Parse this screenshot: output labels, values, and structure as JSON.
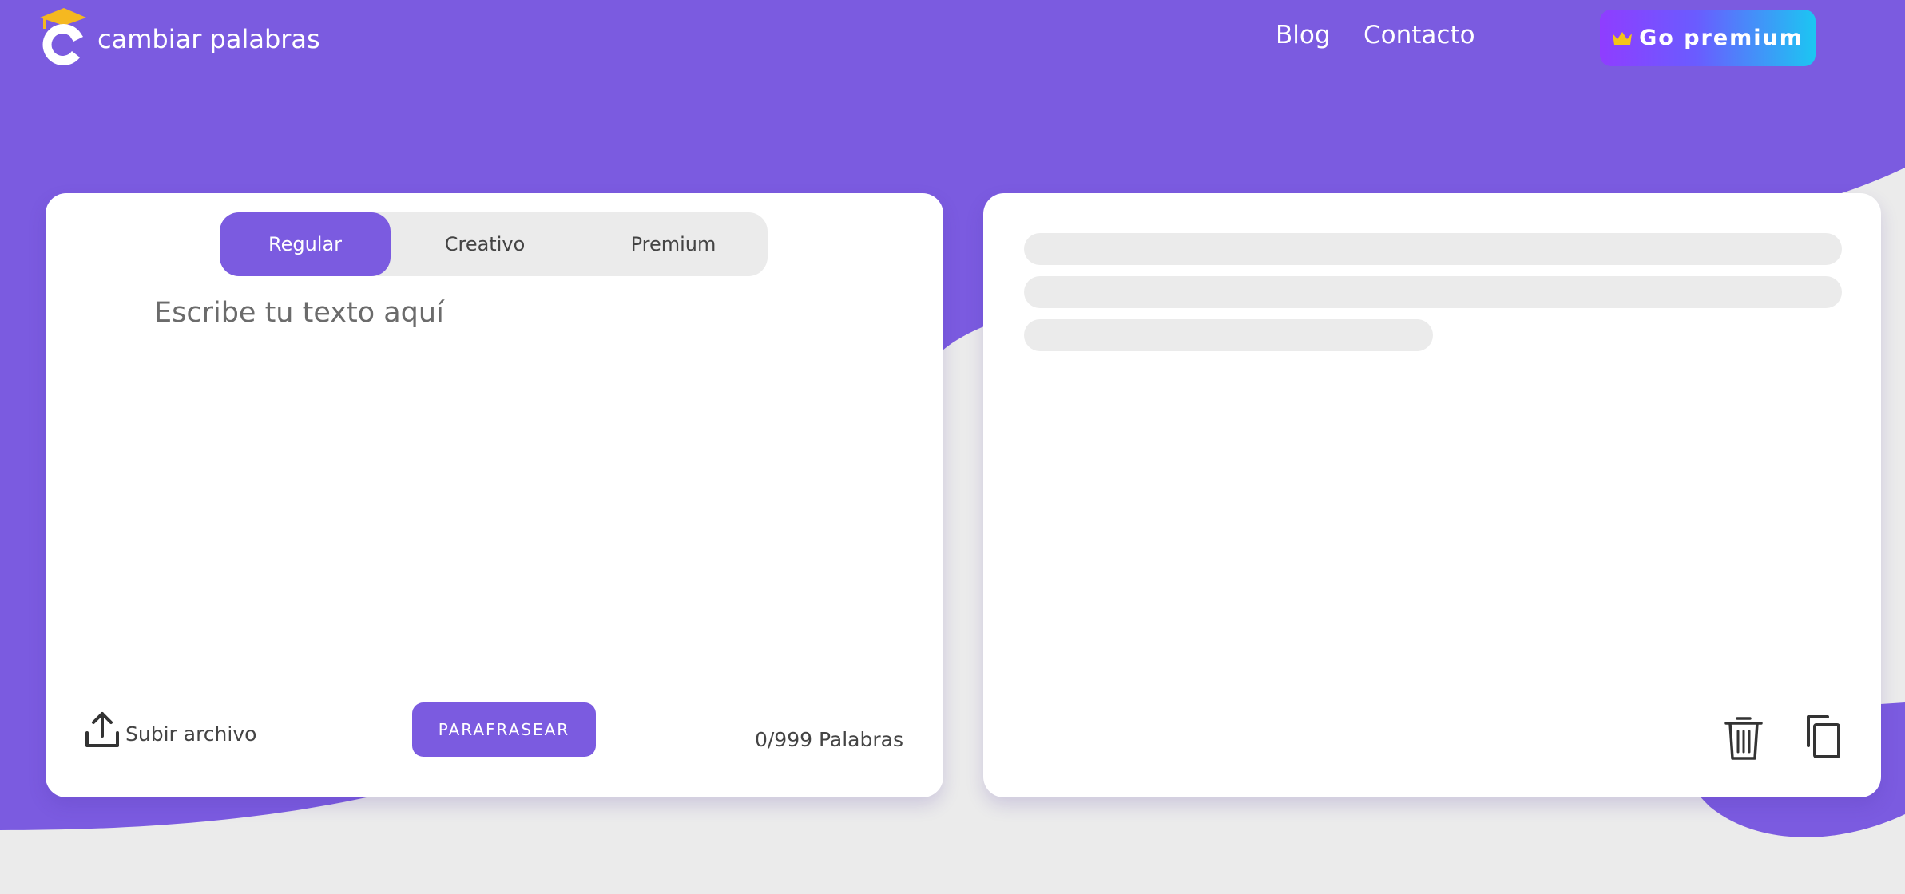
{
  "header": {
    "logo_text": "cambiar palabras",
    "nav": [
      "Blog",
      "Contacto"
    ],
    "premium_label": "Go premium"
  },
  "editor": {
    "modes": [
      "Regular",
      "Creativo",
      "Premium"
    ],
    "active_mode": "Regular",
    "placeholder": "Escribe tu texto aquí",
    "value": "",
    "upload_label": "Subir archivo",
    "paraphrase_label": "PARAFRASEAR",
    "word_count": "0/999 Palabras"
  },
  "output": {
    "status": "loading",
    "actions": [
      "trash-icon",
      "copy-icon"
    ]
  },
  "colors": {
    "primary": "#7b5be0",
    "background": "#ebebeb",
    "card": "#ffffff",
    "accent_gold": "#f5b820",
    "premium_gradient_start": "#8f3dff",
    "premium_gradient_end": "#1cc6f2"
  }
}
